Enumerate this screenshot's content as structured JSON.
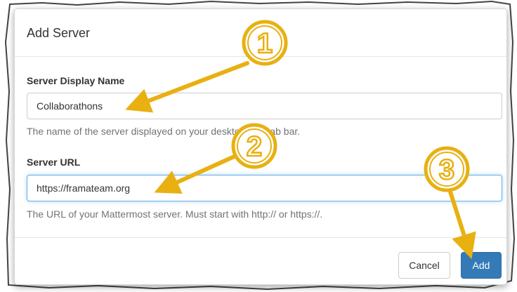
{
  "dialog": {
    "title": "Add Server"
  },
  "fields": {
    "name": {
      "label": "Server Display Name",
      "value": "Collaborathons",
      "help": "The name of the server displayed on your desktop app tab bar."
    },
    "url": {
      "label": "Server URL",
      "value": "https://framateam.org",
      "help": "The URL of your Mattermost server. Must start with http:// or https://."
    }
  },
  "footer": {
    "cancel_label": "Cancel",
    "add_label": "Add"
  },
  "annotations": {
    "callouts": [
      "1",
      "2",
      "3"
    ],
    "color": "#e8b011"
  },
  "colors": {
    "primary_button": "#337ab7",
    "focus_border": "#66afe9",
    "help_text": "#737373"
  }
}
